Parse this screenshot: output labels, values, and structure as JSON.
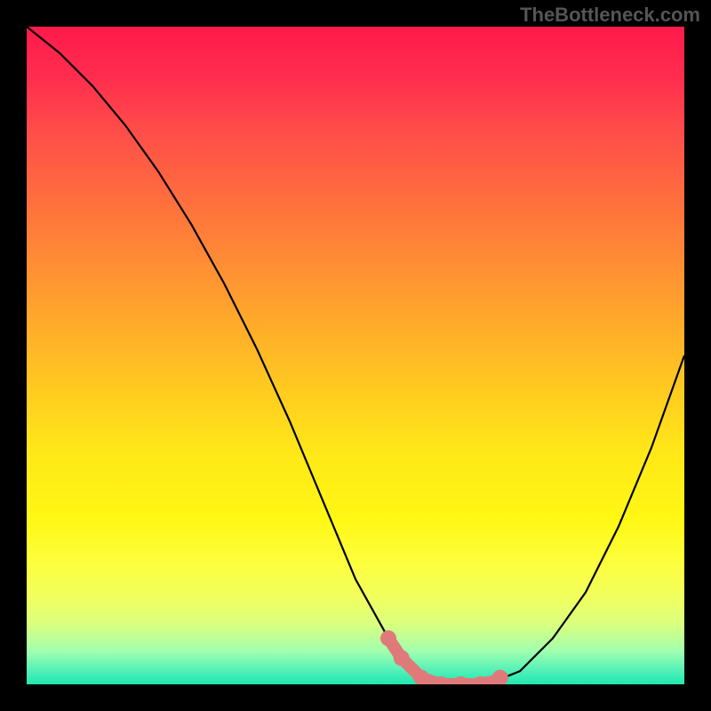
{
  "watermark": "TheBottleneck.com",
  "chart_data": {
    "type": "line",
    "title": "",
    "xlabel": "",
    "ylabel": "",
    "xlim": [
      0,
      100
    ],
    "ylim": [
      0,
      100
    ],
    "series": [
      {
        "name": "curve",
        "x": [
          0,
          5,
          10,
          15,
          20,
          25,
          30,
          35,
          40,
          45,
          50,
          55,
          58,
          60,
          63,
          66,
          70,
          75,
          80,
          85,
          90,
          95,
          100
        ],
        "y": [
          100,
          96,
          91,
          85,
          78,
          70,
          61,
          51,
          40,
          28,
          16,
          7,
          3,
          1,
          0,
          0,
          0,
          2,
          7,
          14,
          24,
          36,
          50
        ]
      }
    ],
    "markers": {
      "name": "highlight-points",
      "color": "#e07a7a",
      "x": [
        55,
        57,
        60,
        63,
        66,
        69,
        70,
        72
      ],
      "y": [
        7,
        4,
        1,
        0,
        0,
        0,
        0,
        1
      ]
    }
  }
}
